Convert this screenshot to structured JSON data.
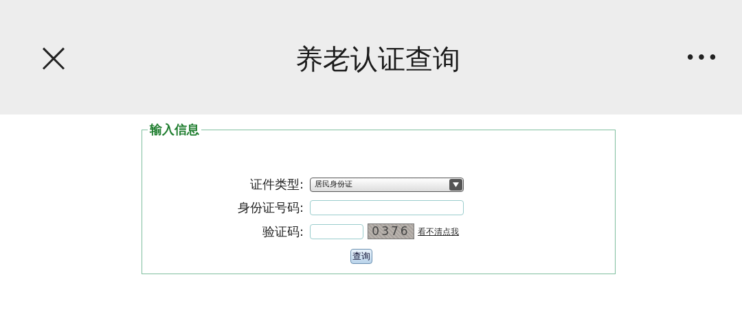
{
  "header": {
    "title": "养老认证查询",
    "close_icon": "×",
    "more_icon": "•••"
  },
  "form": {
    "legend": "输入信息",
    "id_type": {
      "label": "证件类型:",
      "value": "居民身份证"
    },
    "id_number": {
      "label": "身份证号码:"
    },
    "captcha": {
      "label": "验证码:",
      "code": "0376",
      "refresh_link": "看不清点我"
    },
    "submit": "查询"
  }
}
